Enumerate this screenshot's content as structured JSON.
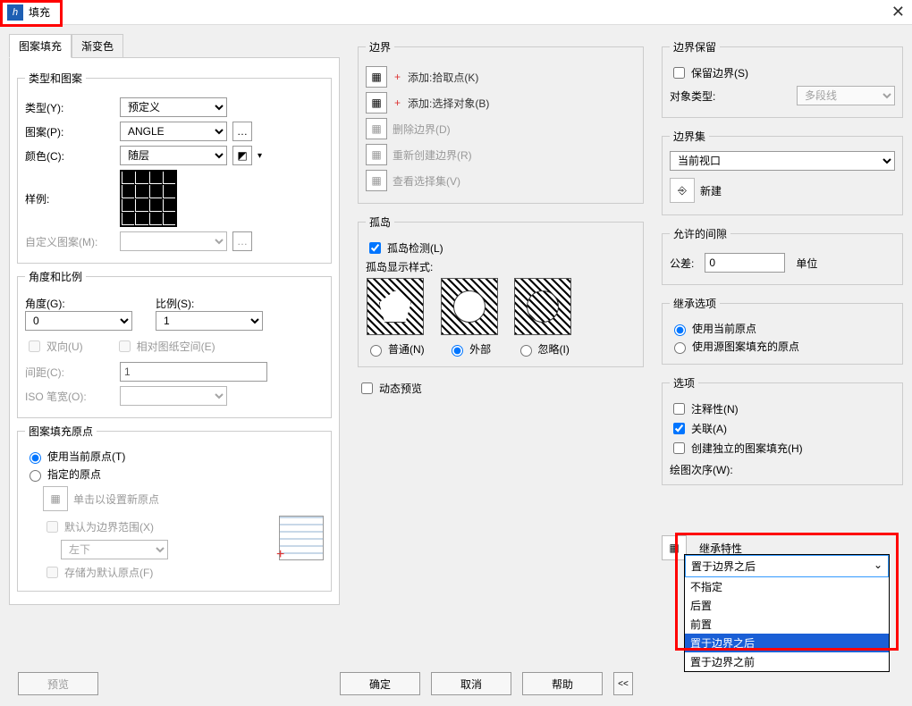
{
  "window": {
    "title": "填充"
  },
  "tabs": {
    "pattern": "图案填充",
    "gradient": "渐变色"
  },
  "type_pattern": {
    "legend": "类型和图案",
    "type_label": "类型(Y):",
    "type_value": "预定义",
    "pattern_label": "图案(P):",
    "pattern_value": "ANGLE",
    "color_label": "颜色(C):",
    "color_value": "随层",
    "sample_label": "样例:",
    "custom_label": "自定义图案(M):"
  },
  "angle_scale": {
    "legend": "角度和比例",
    "angle_label": "角度(G):",
    "angle_value": "0",
    "scale_label": "比例(S):",
    "scale_value": "1",
    "bidir": "双向(U)",
    "paper_space": "相对图纸空间(E)",
    "spacing_label": "间距(C):",
    "spacing_value": "1",
    "iso_label": "ISO 笔宽(O):"
  },
  "origin": {
    "legend": "图案填充原点",
    "use_current": "使用当前原点(T)",
    "specified": "指定的原点",
    "click_set": "单击以设置新原点",
    "default_boundary": "默认为边界范围(X)",
    "pos_value": "左下",
    "store_default": "存储为默认原点(F)"
  },
  "boundary": {
    "legend": "边界",
    "add_pick": "添加:拾取点(K)",
    "add_select": "添加:选择对象(B)",
    "delete": "删除边界(D)",
    "recreate": "重新创建边界(R)",
    "view_sel": "查看选择集(V)"
  },
  "islands": {
    "legend": "孤岛",
    "detect": "孤岛检测(L)",
    "style_label": "孤岛显示样式:",
    "normal": "普通(N)",
    "outer": "外部",
    "ignore": "忽略(I)"
  },
  "dynamic_preview": "动态预览",
  "boundary_keep": {
    "legend": "边界保留",
    "keep": "保留边界(S)",
    "obj_type_label": "对象类型:",
    "obj_type_value": "多段线"
  },
  "boundary_set": {
    "legend": "边界集",
    "value": "当前视口",
    "new_btn": "新建"
  },
  "gap": {
    "legend": "允许的间隙",
    "tol_label": "公差:",
    "tol_value": "0",
    "unit": "单位"
  },
  "inherit": {
    "legend": "继承选项",
    "use_current": "使用当前原点",
    "use_source": "使用源图案填充的原点"
  },
  "options": {
    "legend": "选项",
    "annotative": "注释性(N)",
    "associative": "关联(A)",
    "independent": "创建独立的图案填充(H)",
    "draw_order_label": "绘图次序(W):",
    "draw_order_value": "置于边界之后",
    "draw_order_opts": [
      "不指定",
      "后置",
      "前置",
      "置于边界之后",
      "置于边界之前"
    ]
  },
  "inherit_props": "继承特性",
  "buttons": {
    "preview": "预览",
    "ok": "确定",
    "cancel": "取消",
    "help": "帮助"
  }
}
